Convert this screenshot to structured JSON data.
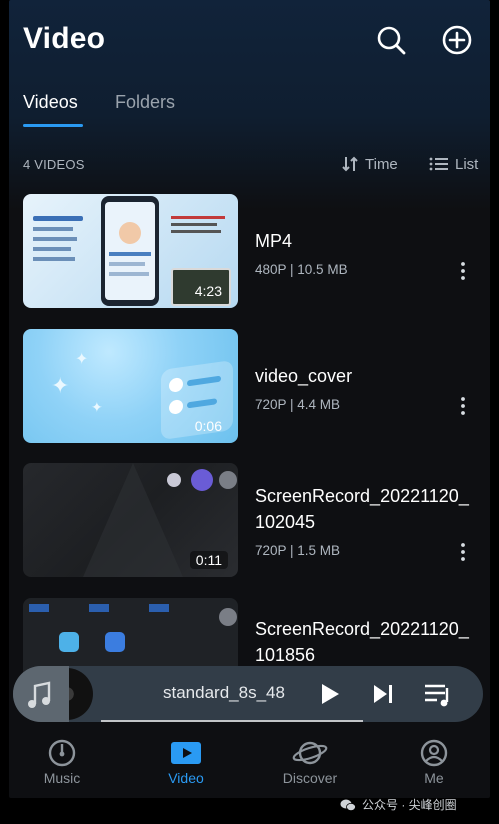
{
  "header": {
    "title": "Video",
    "actions": [
      "search-icon",
      "add-circle-icon"
    ]
  },
  "tabs": [
    {
      "label": "Videos",
      "active": true
    },
    {
      "label": "Folders",
      "active": false
    }
  ],
  "list_header": {
    "count": "4 VIDEOS",
    "sort_label": "Time",
    "view_label": "List"
  },
  "videos": [
    {
      "title": "MP4",
      "meta": "480P | 10.5 MB",
      "duration": "4:23"
    },
    {
      "title": "video_cover",
      "meta": "720P | 4.4 MB",
      "duration": "0:06"
    },
    {
      "title": "ScreenRecord_20221120_102045",
      "meta": "720P | 1.5 MB",
      "duration": "0:11"
    },
    {
      "title": "ScreenRecord_20221120_101856",
      "meta": "",
      "duration": ""
    }
  ],
  "mini_player": {
    "title": "standard_8s_48",
    "controls": [
      "play-icon",
      "skip-next-icon",
      "playlist-icon"
    ]
  },
  "bottom_nav": [
    {
      "label": "Music",
      "icon": "music-disc-icon",
      "active": false
    },
    {
      "label": "Video",
      "icon": "video-play-icon",
      "active": true
    },
    {
      "label": "Discover",
      "icon": "planet-icon",
      "active": false
    },
    {
      "label": "Me",
      "icon": "person-icon",
      "active": false
    }
  ],
  "colors": {
    "accent": "#2a9af3",
    "background": "#0e0f12",
    "secondary_text": "#aeb6bf"
  },
  "watermark": "公众号 · 尖峰创圈"
}
